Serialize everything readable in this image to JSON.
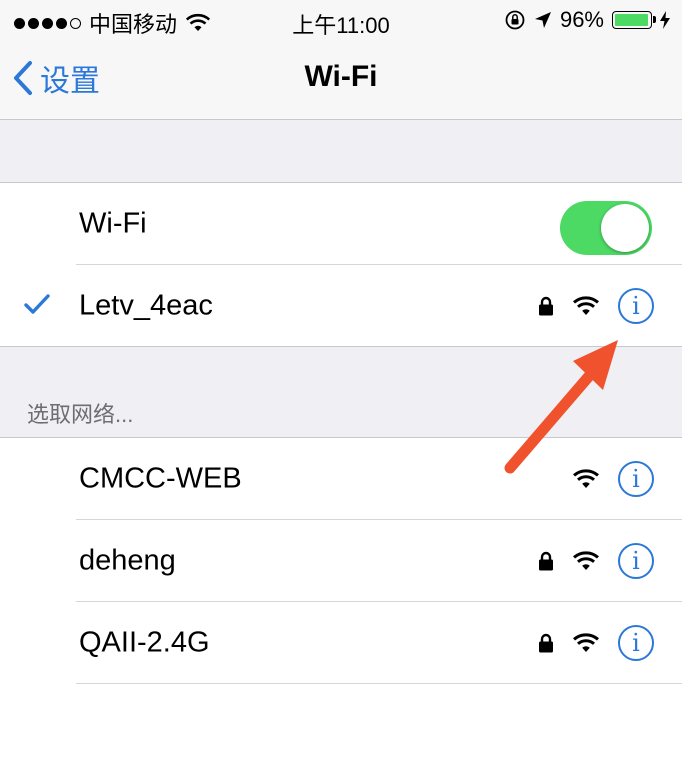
{
  "status_bar": {
    "carrier": "中国移动",
    "time": "上午11:00",
    "battery_percent": "96%",
    "battery_level": 0.96,
    "signal_bars_filled": 4,
    "icons": [
      "signal-dots-icon",
      "wifi-icon",
      "rotation-lock-icon",
      "location-icon",
      "battery-icon",
      "charging-bolt-icon"
    ]
  },
  "nav": {
    "back_label": "设置",
    "title": "Wi-Fi"
  },
  "wifi_toggle": {
    "label": "Wi-Fi",
    "on": true
  },
  "connected_network": {
    "name": "Letv_4eac",
    "secured": true
  },
  "networks_header": "选取网络...",
  "networks": [
    {
      "name": "CMCC-WEB",
      "secured": false
    },
    {
      "name": "deheng",
      "secured": true
    },
    {
      "name": "QAII-2.4G",
      "secured": true
    }
  ],
  "colors": {
    "accent_blue": "#2b78d8",
    "toggle_green": "#4cd964",
    "annotation_arrow": "#f0522e"
  }
}
